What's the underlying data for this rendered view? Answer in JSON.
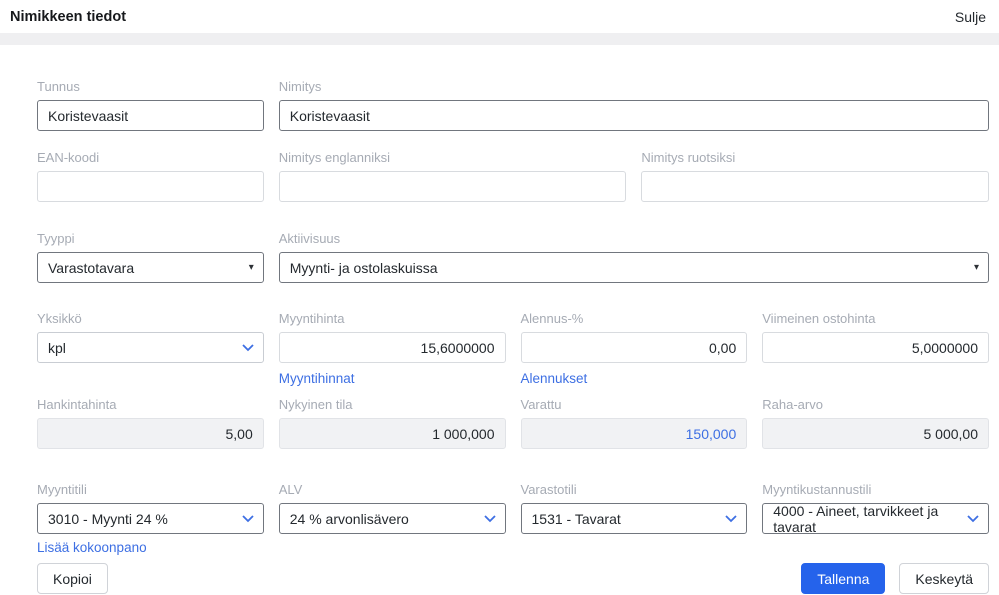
{
  "header": {
    "title": "Nimikkeen tiedot",
    "close": "Sulje"
  },
  "fields": {
    "tunnus": {
      "label": "Tunnus",
      "value": "Koristevaasit"
    },
    "nimitys": {
      "label": "Nimitys",
      "value": "Koristevaasit"
    },
    "ean_koodi": {
      "label": "EAN-koodi",
      "value": ""
    },
    "nimitys_englanniksi": {
      "label": "Nimitys englanniksi",
      "value": ""
    },
    "nimitys_ruotsiksi": {
      "label": "Nimitys ruotsiksi",
      "value": ""
    },
    "tyyppi": {
      "label": "Tyyppi",
      "value": "Varastotavara"
    },
    "aktiivisuus": {
      "label": "Aktiivisuus",
      "value": "Myynti- ja ostolaskuissa"
    },
    "yksikko": {
      "label": "Yksikkö",
      "value": "kpl"
    },
    "myyntihinta": {
      "label": "Myyntihinta",
      "value": "15,6000000",
      "link": "Myyntihinnat"
    },
    "alennus_pct": {
      "label": "Alennus-%",
      "value": "0,00",
      "link": "Alennukset"
    },
    "viimeinen_ostohinta": {
      "label": "Viimeinen ostohinta",
      "value": "5,0000000"
    },
    "hankintahinta": {
      "label": "Hankintahinta",
      "value": "5,00"
    },
    "nykyinen_tila": {
      "label": "Nykyinen tila",
      "value": "1 000,000"
    },
    "varattu": {
      "label": "Varattu",
      "value": "150,000"
    },
    "raha_arvo": {
      "label": "Raha-arvo",
      "value": "5 000,00"
    },
    "myyntitili": {
      "label": "Myyntitili",
      "value": "3010 - Myynti 24 %"
    },
    "alv": {
      "label": "ALV",
      "value": "24 % arvonlisävero"
    },
    "varastotili": {
      "label": "Varastotili",
      "value": "1531 - Tavarat"
    },
    "myyntikustannustili": {
      "label": "Myyntikustannustili",
      "value": "4000 - Aineet, tarvikkeet ja tavarat"
    }
  },
  "links": {
    "lisaa_kokoonpano": "Lisää kokoonpano"
  },
  "actions": {
    "kopioi": "Kopioi",
    "tallenna": "Tallenna",
    "keskeyta": "Keskeytä"
  },
  "colors": {
    "accent": "#2563eb",
    "link": "#3d6fe3"
  }
}
